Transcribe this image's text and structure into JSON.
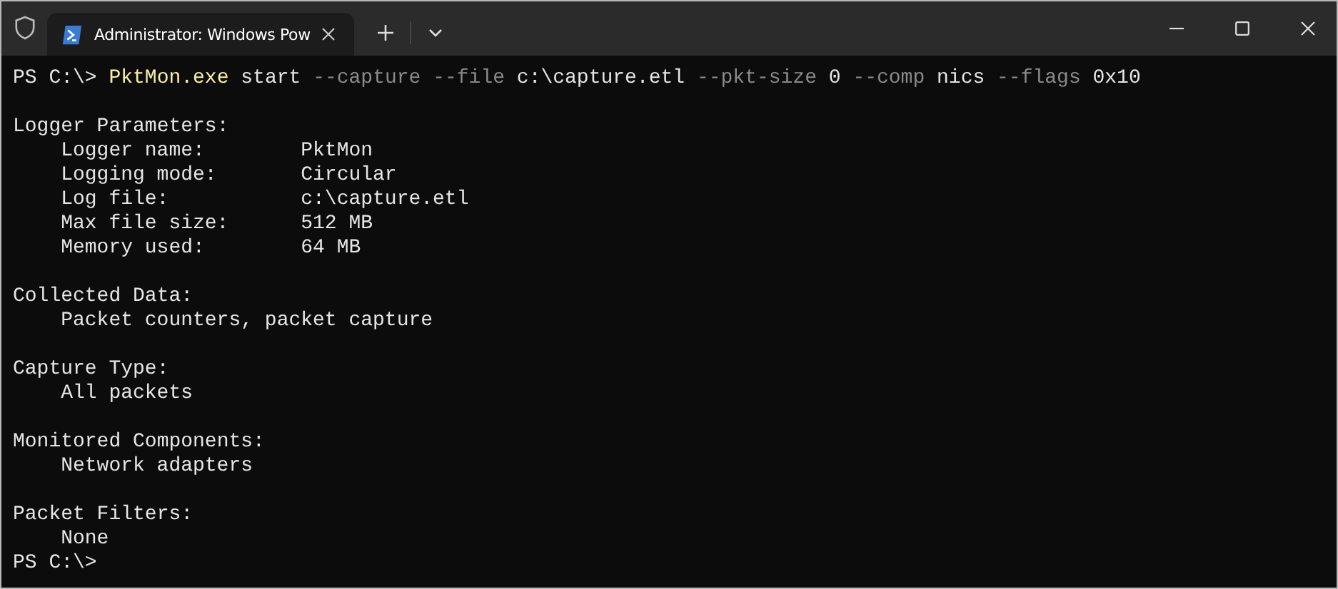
{
  "window": {
    "tab": {
      "title": "Administrator: Windows Pow",
      "selected": true
    }
  },
  "command": {
    "prompt": "PS C:\\>",
    "tokens": [
      {
        "text": "PktMon.exe",
        "kind": "command"
      },
      {
        "text": "start",
        "kind": "arg"
      },
      {
        "text": "--capture",
        "kind": "param"
      },
      {
        "text": "--file",
        "kind": "param"
      },
      {
        "text": "c:\\capture.etl",
        "kind": "arg"
      },
      {
        "text": "--pkt-size",
        "kind": "param"
      },
      {
        "text": "0",
        "kind": "arg"
      },
      {
        "text": "--comp",
        "kind": "param"
      },
      {
        "text": "nics",
        "kind": "arg"
      },
      {
        "text": "--flags",
        "kind": "param"
      },
      {
        "text": "0x10",
        "kind": "arg"
      }
    ]
  },
  "output_blocks": [
    {
      "heading": "Logger Parameters:",
      "fields": [
        {
          "label": "Logger name:",
          "value": "PktMon"
        },
        {
          "label": "Logging mode:",
          "value": "Circular"
        },
        {
          "label": "Log file:",
          "value": "c:\\capture.etl"
        },
        {
          "label": "Max file size:",
          "value": "512 MB"
        },
        {
          "label": "Memory used:",
          "value": "64 MB"
        }
      ]
    },
    {
      "heading": "Collected Data:",
      "lines": [
        "Packet counters, packet capture"
      ]
    },
    {
      "heading": "Capture Type:",
      "lines": [
        "All packets"
      ]
    },
    {
      "heading": "Monitored Components:",
      "lines": [
        "Network adapters"
      ]
    },
    {
      "heading": "Packet Filters:",
      "lines": [
        "None"
      ]
    }
  ],
  "final_prompt": "PS C:\\>"
}
